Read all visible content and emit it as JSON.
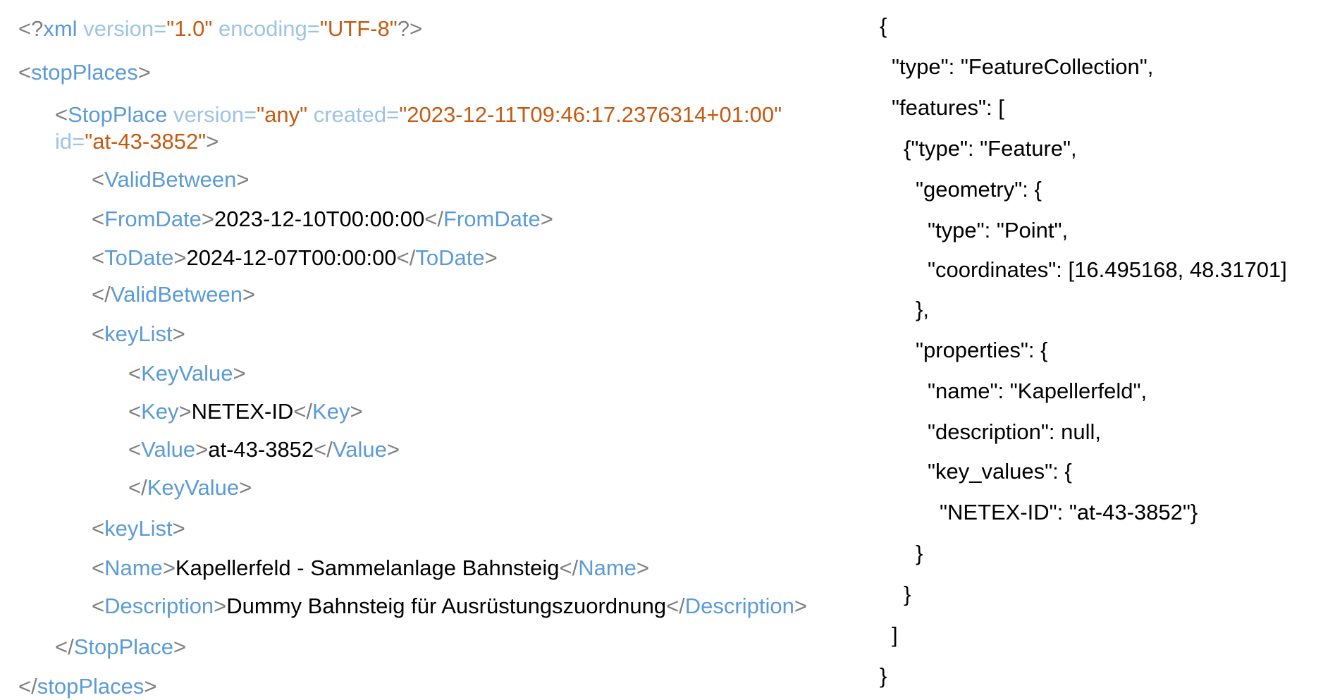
{
  "xml": {
    "lines": [
      {
        "indent": 0,
        "parts": [
          {
            "k": "b",
            "t": "<?"
          },
          {
            "k": "t",
            "t": "xml"
          },
          {
            "k": "a",
            "t": " version="
          },
          {
            "k": "v",
            "t": "\"1.0\""
          },
          {
            "k": "a",
            "t": " encoding="
          },
          {
            "k": "v",
            "t": "\"UTF-8\""
          },
          {
            "k": "b",
            "t": "?>"
          }
        ]
      },
      {
        "indent": 0,
        "parts": [
          {
            "k": "b",
            "t": "<"
          },
          {
            "k": "t",
            "t": "stopPlaces"
          },
          {
            "k": "b",
            "t": ">"
          }
        ]
      },
      {
        "indent": 1,
        "parts": [
          {
            "k": "b",
            "t": "<"
          },
          {
            "k": "t",
            "t": "StopPlace"
          },
          {
            "k": "a",
            "t": " version="
          },
          {
            "k": "v",
            "t": "\"any\""
          },
          {
            "k": "a",
            "t": " created="
          },
          {
            "k": "v",
            "t": "\"2023-12-11T09:46:17.2376314+01:00\""
          }
        ]
      },
      {
        "indent": 1,
        "parts": [
          {
            "k": "a",
            "t": "id="
          },
          {
            "k": "v",
            "t": "\"at-43-3852\""
          },
          {
            "k": "b",
            "t": ">"
          }
        ]
      },
      {
        "indent": 2,
        "parts": [
          {
            "k": "b",
            "t": "<"
          },
          {
            "k": "t",
            "t": "ValidBetween"
          },
          {
            "k": "b",
            "t": ">"
          }
        ]
      },
      {
        "indent": 2,
        "parts": [
          {
            "k": "b",
            "t": "<"
          },
          {
            "k": "t",
            "t": "FromDate"
          },
          {
            "k": "b",
            "t": ">"
          },
          {
            "k": "c",
            "t": "2023-12-10T00:00:00"
          },
          {
            "k": "b",
            "t": "</"
          },
          {
            "k": "t",
            "t": "FromDate"
          },
          {
            "k": "b",
            "t": ">"
          }
        ]
      },
      {
        "indent": 2,
        "parts": [
          {
            "k": "b",
            "t": "<"
          },
          {
            "k": "t",
            "t": "ToDate"
          },
          {
            "k": "b",
            "t": ">"
          },
          {
            "k": "c",
            "t": "2024-12-07T00:00:00"
          },
          {
            "k": "b",
            "t": "</"
          },
          {
            "k": "t",
            "t": "ToDate"
          },
          {
            "k": "b",
            "t": ">"
          }
        ]
      },
      {
        "indent": 2,
        "parts": [
          {
            "k": "b",
            "t": "</"
          },
          {
            "k": "t",
            "t": "ValidBetween"
          },
          {
            "k": "b",
            "t": ">"
          }
        ]
      },
      {
        "indent": 2,
        "parts": [
          {
            "k": "b",
            "t": "<"
          },
          {
            "k": "t",
            "t": "keyList"
          },
          {
            "k": "b",
            "t": ">"
          }
        ]
      },
      {
        "indent": 3,
        "parts": [
          {
            "k": "b",
            "t": "<"
          },
          {
            "k": "t",
            "t": "KeyValue"
          },
          {
            "k": "b",
            "t": ">"
          }
        ]
      },
      {
        "indent": 3,
        "parts": [
          {
            "k": "b",
            "t": "<"
          },
          {
            "k": "t",
            "t": "Key"
          },
          {
            "k": "b",
            "t": ">"
          },
          {
            "k": "c",
            "t": "NETEX-ID"
          },
          {
            "k": "b",
            "t": "</"
          },
          {
            "k": "t",
            "t": "Key"
          },
          {
            "k": "b",
            "t": ">"
          }
        ]
      },
      {
        "indent": 3,
        "parts": [
          {
            "k": "b",
            "t": "<"
          },
          {
            "k": "t",
            "t": "Value"
          },
          {
            "k": "b",
            "t": ">"
          },
          {
            "k": "c",
            "t": "at-43-3852"
          },
          {
            "k": "b",
            "t": "</"
          },
          {
            "k": "t",
            "t": "Value"
          },
          {
            "k": "b",
            "t": ">"
          }
        ]
      },
      {
        "indent": 3,
        "parts": [
          {
            "k": "b",
            "t": "</"
          },
          {
            "k": "t",
            "t": "KeyValue"
          },
          {
            "k": "b",
            "t": ">"
          }
        ]
      },
      {
        "indent": 2,
        "parts": [
          {
            "k": "b",
            "t": "<"
          },
          {
            "k": "t",
            "t": "keyList"
          },
          {
            "k": "b",
            "t": ">"
          }
        ]
      },
      {
        "indent": 2,
        "parts": [
          {
            "k": "b",
            "t": "<"
          },
          {
            "k": "t",
            "t": "Name"
          },
          {
            "k": "b",
            "t": ">"
          },
          {
            "k": "c",
            "t": "Kapellerfeld - Sammelanlage Bahnsteig"
          },
          {
            "k": "b",
            "t": "</"
          },
          {
            "k": "t",
            "t": "Name"
          },
          {
            "k": "b",
            "t": ">"
          }
        ]
      },
      {
        "indent": 2,
        "parts": [
          {
            "k": "b",
            "t": "<"
          },
          {
            "k": "t",
            "t": "Description"
          },
          {
            "k": "b",
            "t": ">"
          },
          {
            "k": "c",
            "t": "Dummy Bahnsteig für Ausrüstungszuordnung"
          },
          {
            "k": "b",
            "t": "</"
          },
          {
            "k": "t",
            "t": "Description"
          },
          {
            "k": "b",
            "t": ">"
          }
        ]
      },
      {
        "indent": 1,
        "parts": [
          {
            "k": "b",
            "t": "</"
          },
          {
            "k": "t",
            "t": "StopPlace"
          },
          {
            "k": "b",
            "t": ">"
          }
        ]
      },
      {
        "indent": 0,
        "parts": [
          {
            "k": "b",
            "t": "</"
          },
          {
            "k": "t",
            "t": "stopPlaces"
          },
          {
            "k": "b",
            "t": ">"
          }
        ]
      }
    ]
  },
  "json": {
    "lines": [
      {
        "indent": 0,
        "text": "{"
      },
      {
        "indent": 1,
        "text": "\"type\": \"FeatureCollection\","
      },
      {
        "indent": 1,
        "text": "\"features\": ["
      },
      {
        "indent": 2,
        "text": "{\"type\": \"Feature\","
      },
      {
        "indent": 3,
        "text": "\"geometry\": {"
      },
      {
        "indent": 4,
        "text": "\"type\": \"Point\","
      },
      {
        "indent": 4,
        "text": "\"coordinates\": [16.495168, 48.31701]"
      },
      {
        "indent": 3,
        "text": "},"
      },
      {
        "indent": 3,
        "text": "\"properties\": {"
      },
      {
        "indent": 4,
        "text": "\"name\": \"Kapellerfeld\","
      },
      {
        "indent": 4,
        "text": "\"description\": null,"
      },
      {
        "indent": 4,
        "text": "\"key_values\": {"
      },
      {
        "indent": 5,
        "text": "\"NETEX-ID\": \"at-43-3852\"}"
      },
      {
        "indent": 3,
        "text": "}"
      },
      {
        "indent": 2,
        "text": "}"
      },
      {
        "indent": 1,
        "text": "]"
      },
      {
        "indent": 0,
        "text": "}"
      }
    ]
  }
}
